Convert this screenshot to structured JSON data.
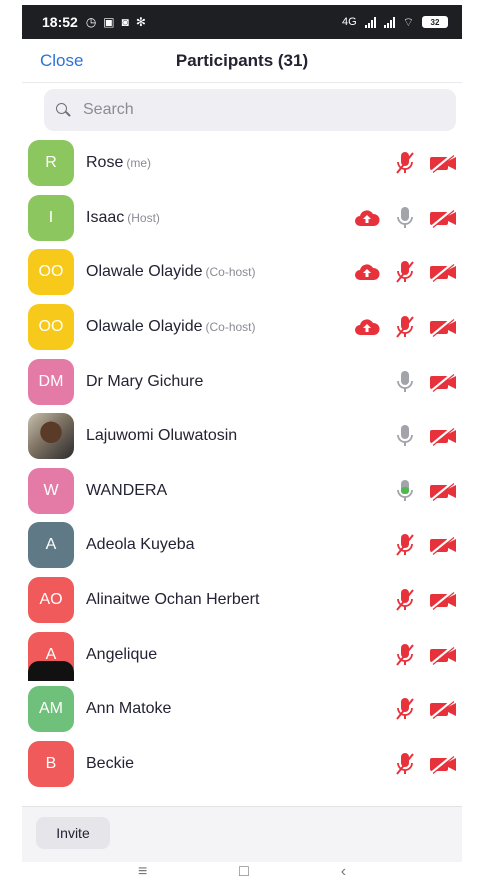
{
  "status_bar": {
    "time": "18:52",
    "network": "4G",
    "battery": "32"
  },
  "header": {
    "close_label": "Close",
    "title": "Participants (31)"
  },
  "search": {
    "placeholder": "Search"
  },
  "participants": [
    {
      "initials": "R",
      "name": "Rose",
      "role": "(me)",
      "avatar_color": "#8cc65f",
      "cloud": false,
      "mic": "muted",
      "video": "off"
    },
    {
      "initials": "I",
      "name": "Isaac",
      "role": "(Host)",
      "avatar_color": "#8cc65f",
      "cloud": true,
      "mic": "on",
      "video": "off"
    },
    {
      "initials": "OO",
      "name": "Olawale Olayide",
      "role": "(Co-host)",
      "avatar_color": "#f6c91a",
      "cloud": true,
      "mic": "muted",
      "video": "off"
    },
    {
      "initials": "OO",
      "name": "Olawale Olayide",
      "role": "(Co-host)",
      "avatar_color": "#f6c91a",
      "cloud": true,
      "mic": "muted",
      "video": "off"
    },
    {
      "initials": "DM",
      "name": "Dr Mary Gichure",
      "role": "",
      "avatar_color": "#e47aa6",
      "cloud": false,
      "mic": "on",
      "video": "off"
    },
    {
      "initials": "",
      "name": "Lajuwomi Oluwatosin",
      "role": "",
      "avatar_color": "photo",
      "cloud": false,
      "mic": "on",
      "video": "off"
    },
    {
      "initials": "W",
      "name": "WANDERA",
      "role": "",
      "avatar_color": "#e47aa6",
      "cloud": false,
      "mic": "speaking",
      "video": "off"
    },
    {
      "initials": "A",
      "name": "Adeola Kuyeba",
      "role": "",
      "avatar_color": "#5f7a86",
      "cloud": false,
      "mic": "muted",
      "video": "off"
    },
    {
      "initials": "AO",
      "name": "Alinaitwe Ochan Herbert",
      "role": "",
      "avatar_color": "#f05a5a",
      "cloud": false,
      "mic": "muted",
      "video": "off"
    },
    {
      "initials": "A",
      "name": "Angelique",
      "role": "",
      "avatar_color": "#f05a5a",
      "cloud": false,
      "mic": "muted",
      "video": "off"
    },
    {
      "initials": "AM",
      "name": "Ann Matoke",
      "role": "",
      "avatar_color": "#6fc07a",
      "cloud": false,
      "mic": "muted",
      "video": "off"
    },
    {
      "initials": "B",
      "name": "Beckie",
      "role": "",
      "avatar_color": "#f05a5a",
      "cloud": false,
      "mic": "muted",
      "video": "off"
    }
  ],
  "footer": {
    "invite_label": "Invite"
  },
  "nav": {
    "menu_glyph": "≡",
    "home_glyph": "□",
    "back_glyph": "‹"
  },
  "colors": {
    "accent": "#2d73d6",
    "muted_red": "#e8323b",
    "mic_grey": "#a3a3ab",
    "mic_green": "#4fb84f"
  }
}
